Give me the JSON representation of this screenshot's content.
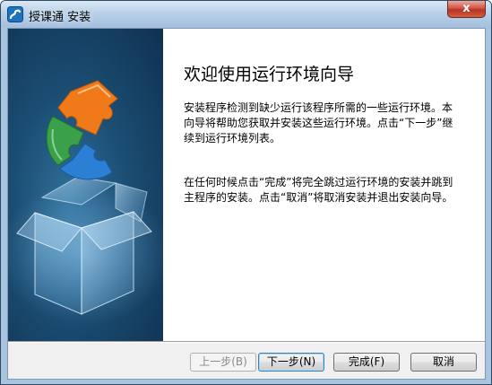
{
  "window": {
    "title": "授课通 安装",
    "close_glyph": "x"
  },
  "wizard": {
    "heading": "欢迎使用运行环境向导",
    "paragraph1": "安装程序检测到缺少运行该程序所需的一些运行环境。本向导将帮助您获取并安装这些运行环境。点击“下一步”继续到运行环境列表。",
    "paragraph2": "在任何时候点击“完成”将完全跳过运行环境的安装并跳到主程序的安装。点击“取消”将取消安装并退出安装向导。"
  },
  "buttons": {
    "back": "上一步(B)",
    "next": "下一步(N)",
    "finish": "完成(F)",
    "cancel": "取消"
  },
  "icons": {
    "app": "app-logo-icon",
    "banner": "puzzle-box-illustration"
  },
  "colors": {
    "accent": "#3c7fb1",
    "banner_bg": "#1b4d73",
    "puzzle_orange": "#f07a1a",
    "puzzle_green": "#3aa14a",
    "puzzle_blue": "#2b7fd4"
  }
}
